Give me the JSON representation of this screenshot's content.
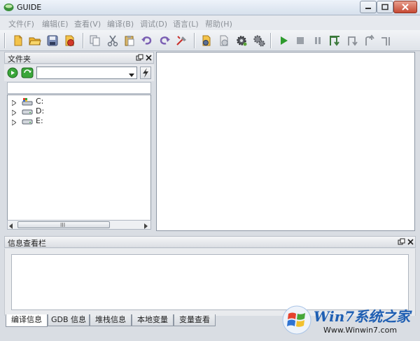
{
  "window": {
    "title": "GUIDE"
  },
  "menu": [
    {
      "label": "文件(F)"
    },
    {
      "label": "编辑(E)"
    },
    {
      "label": "查看(V)"
    },
    {
      "label": "编译(B)"
    },
    {
      "label": "调试(D)"
    },
    {
      "label": "语言(L)"
    },
    {
      "label": "帮助(H)"
    }
  ],
  "toolbar": {
    "icons": [
      "new-file-icon",
      "open-folder-icon",
      "save-icon",
      "save-all-icon",
      "copy-icon",
      "cut-icon",
      "paste-icon",
      "undo-icon",
      "redo-icon",
      "clear-icon",
      "compile-icon",
      "build-icon",
      "gear-icon",
      "gears-icon",
      "run-icon",
      "stop-icon",
      "pause-icon",
      "step-into-icon",
      "step-over-icon",
      "step-out-icon",
      "run-to-cursor-icon"
    ],
    "colors": {
      "run": "#2e9b2e",
      "disabled": "#9aa0a8",
      "debug": "#3c7a3c"
    }
  },
  "left_panel": {
    "title": "文件夹",
    "drives": [
      {
        "label": "C:"
      },
      {
        "label": "D:"
      },
      {
        "label": "E:"
      }
    ],
    "scroll_grip": "III"
  },
  "bottom_panel": {
    "title": "信息查看栏",
    "tabs": [
      {
        "label": "编译信息"
      },
      {
        "label": "GDB 信息"
      },
      {
        "label": "堆栈信息"
      },
      {
        "label": "本地变量"
      },
      {
        "label": "变量查看"
      }
    ]
  },
  "watermark": {
    "brand": "Win7系统之家",
    "url": "Www.Winwin7.com"
  }
}
